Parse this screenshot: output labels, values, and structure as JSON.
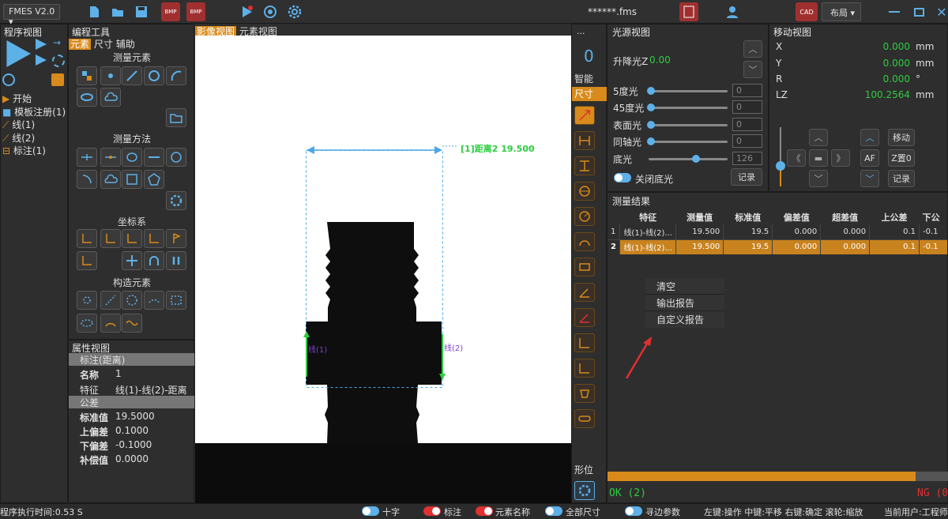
{
  "app": {
    "name": "FMES V2.0",
    "file": "******.fms",
    "layout_btn": "布局",
    "cad_btn": "CAD"
  },
  "program_view": {
    "title": "程序视图",
    "tree": [
      "开始",
      "模板注册(1)",
      "线(1)",
      "线(2)",
      "标注(1)"
    ]
  },
  "edit_tools": {
    "title": "编程工具",
    "tabs": [
      "元素",
      "尺寸",
      "辅助"
    ],
    "sections": {
      "measure_elements": "测量元素",
      "measure_methods": "测量方法",
      "coord_system": "坐标系",
      "construct_elements": "构造元素"
    }
  },
  "property_view": {
    "title": "属性视图",
    "group1": "标注(距离)",
    "name_label": "名称",
    "name_value": "1",
    "feature_label": "特征",
    "feature_value": "线(1)-线(2)-距离",
    "group2": "公差",
    "nominal_label": "标准值",
    "nominal_value": "19.5000",
    "upper_label": "上偏差",
    "upper_value": "0.1000",
    "lower_label": "下偏差",
    "lower_value": "-0.1000",
    "comp_label": "补偿值",
    "comp_value": "0.0000"
  },
  "image_view": {
    "tabs": [
      "影像视图",
      "元素视图"
    ],
    "dimension_label": "[1]距离2 19.500",
    "line1": "线(1)",
    "line2": "线(2)"
  },
  "vertical_tools": {
    "top_label": "...",
    "counter": "0",
    "smart": "智能",
    "size": "尺寸",
    "form": "形位"
  },
  "light_view": {
    "title": "光源视图",
    "lift_label": "升降光Z",
    "lift_value": "0.00",
    "lights": [
      {
        "label": "5度光",
        "value": "0"
      },
      {
        "label": "45度光",
        "value": "0"
      },
      {
        "label": "表面光",
        "value": "0"
      },
      {
        "label": "同轴光",
        "value": "0"
      },
      {
        "label": "底光",
        "value": "126"
      }
    ],
    "close_bottom": "关闭底光",
    "record": "记录"
  },
  "motion_view": {
    "title": "移动视图",
    "axes": [
      {
        "label": "X",
        "value": "0.000",
        "unit": "mm"
      },
      {
        "label": "Y",
        "value": "0.000",
        "unit": "mm"
      },
      {
        "label": "R",
        "value": "0.000",
        "unit": "°"
      },
      {
        "label": "LZ",
        "value": "100.2564",
        "unit": "mm"
      }
    ],
    "move": "移动",
    "af": "AF",
    "z_zero": "Z置0",
    "record": "记录"
  },
  "results": {
    "title": "测量结果",
    "headers": [
      "特征",
      "测量值",
      "标准值",
      "偏差值",
      "超差值",
      "上公差",
      "下公"
    ],
    "rows": [
      {
        "idx": "1",
        "feature": "线(1)-线(2)...",
        "measured": "19.500",
        "nominal": "19.5",
        "dev": "0.000",
        "over": "0.000",
        "upper": "0.1",
        "lower": "-0.1"
      },
      {
        "idx": "2",
        "feature": "线(1)-线(2)...",
        "measured": "19.500",
        "nominal": "19.5",
        "dev": "0.000",
        "over": "0.000",
        "upper": "0.1",
        "lower": "-0.1"
      }
    ],
    "menu": [
      "清空",
      "输出报告",
      "自定义报告"
    ],
    "ok": "OK (2)",
    "ng": "NG (0"
  },
  "status": {
    "exec_time": "程序执行时间:0.53 S",
    "toggles": [
      "十字",
      "标注",
      "元素名称",
      "全部尺寸",
      "寻边参数"
    ],
    "hints": "左键:操作  中键:平移  右键:确定  滚轮:缩放",
    "user": "当前用户:工程师"
  },
  "colors": {
    "accent": "#d88a1a",
    "green": "#2ecc40",
    "blue": "#4aa8e8",
    "red": "#e03030"
  }
}
